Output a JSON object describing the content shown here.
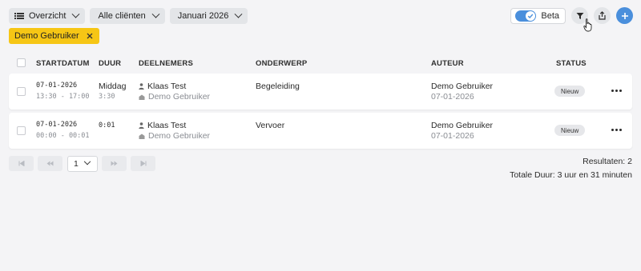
{
  "toolbar": {
    "view_label": "Overzicht",
    "clients_label": "Alle cliënten",
    "month_label": "Januari 2026",
    "beta_label": "Beta"
  },
  "active_filter": {
    "label": "Demo Gebruiker"
  },
  "table": {
    "headers": {
      "startdatum": "STARTDATUM",
      "duur": "DUUR",
      "deelnemers": "DEELNEMERS",
      "onderwerp": "ONDERWERP",
      "auteur": "AUTEUR",
      "status": "STATUS"
    },
    "rows": [
      {
        "date": "07-01-2026",
        "time": "13:30 - 17:00",
        "duration": "Middag",
        "duration_sub": "3:30",
        "participant": "Klaas Test",
        "participant_org": "Demo Gebruiker",
        "subject": "Begeleiding",
        "author": "Demo Gebruiker",
        "author_date": "07-01-2026",
        "status": "Nieuw"
      },
      {
        "date": "07-01-2026",
        "time": "00:00 - 00:01",
        "duration": "0:01",
        "duration_sub": "",
        "participant": "Klaas Test",
        "participant_org": "Demo Gebruiker",
        "subject": "Vervoer",
        "author": "Demo Gebruiker",
        "author_date": "07-01-2026",
        "status": "Nieuw"
      }
    ]
  },
  "pagination": {
    "page": "1"
  },
  "summary": {
    "results_label": "Resultaten:",
    "results_count": "2",
    "total_duration": "Totale Duur: 3 uur en 31 minuten"
  },
  "colors": {
    "accent": "#4a8fdc",
    "chip": "#f6c615",
    "badge": "#e6e7ea"
  }
}
